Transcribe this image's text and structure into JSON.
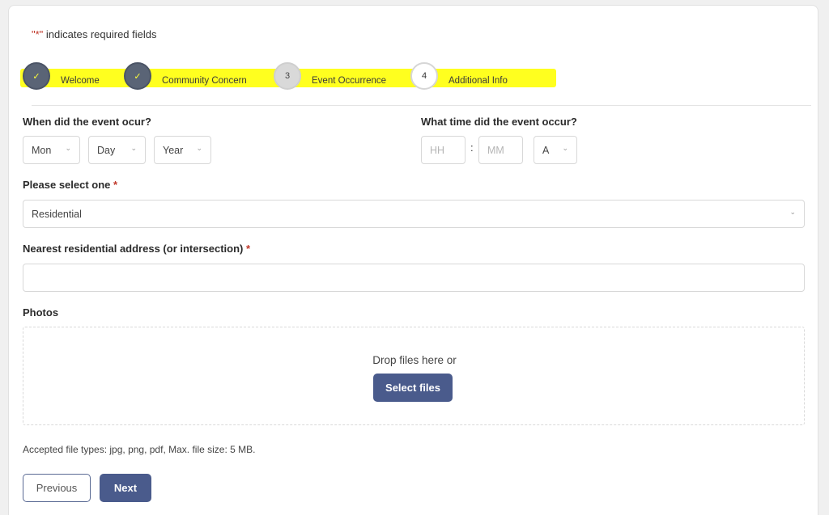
{
  "required_note": {
    "star": "\"*\"",
    "text": " indicates required fields"
  },
  "steps": [
    {
      "marker": "✓",
      "label": "Welcome",
      "state": "done"
    },
    {
      "marker": "✓",
      "label": "Community Concern",
      "state": "done"
    },
    {
      "marker": "3",
      "label": "Event Occurrence",
      "state": "active"
    },
    {
      "marker": "4",
      "label": "Additional Info",
      "state": "todo"
    }
  ],
  "date_field": {
    "label": "When did the event ocur?",
    "month": "Mon",
    "day": "Day",
    "year": "Year"
  },
  "time_field": {
    "label": "What time did the event occur?",
    "hour_placeholder": "HH",
    "colon": ":",
    "minute_placeholder": "MM",
    "ampm": "A"
  },
  "select_one": {
    "label": "Please select one",
    "required": "*",
    "value": "Residential"
  },
  "address": {
    "label": "Nearest residential address (or intersection)",
    "required": "*",
    "value": ""
  },
  "photos": {
    "label": "Photos",
    "drop_text": "Drop files here or",
    "select_button": "Select files",
    "help": "Accepted file types: jpg, png, pdf, Max. file size: 5 MB."
  },
  "nav": {
    "previous": "Previous",
    "next": "Next"
  },
  "colors": {
    "highlight": "#ffff1f",
    "primary": "#4a5b8c",
    "step_done": "#5a6476",
    "required": "#c0392b"
  }
}
